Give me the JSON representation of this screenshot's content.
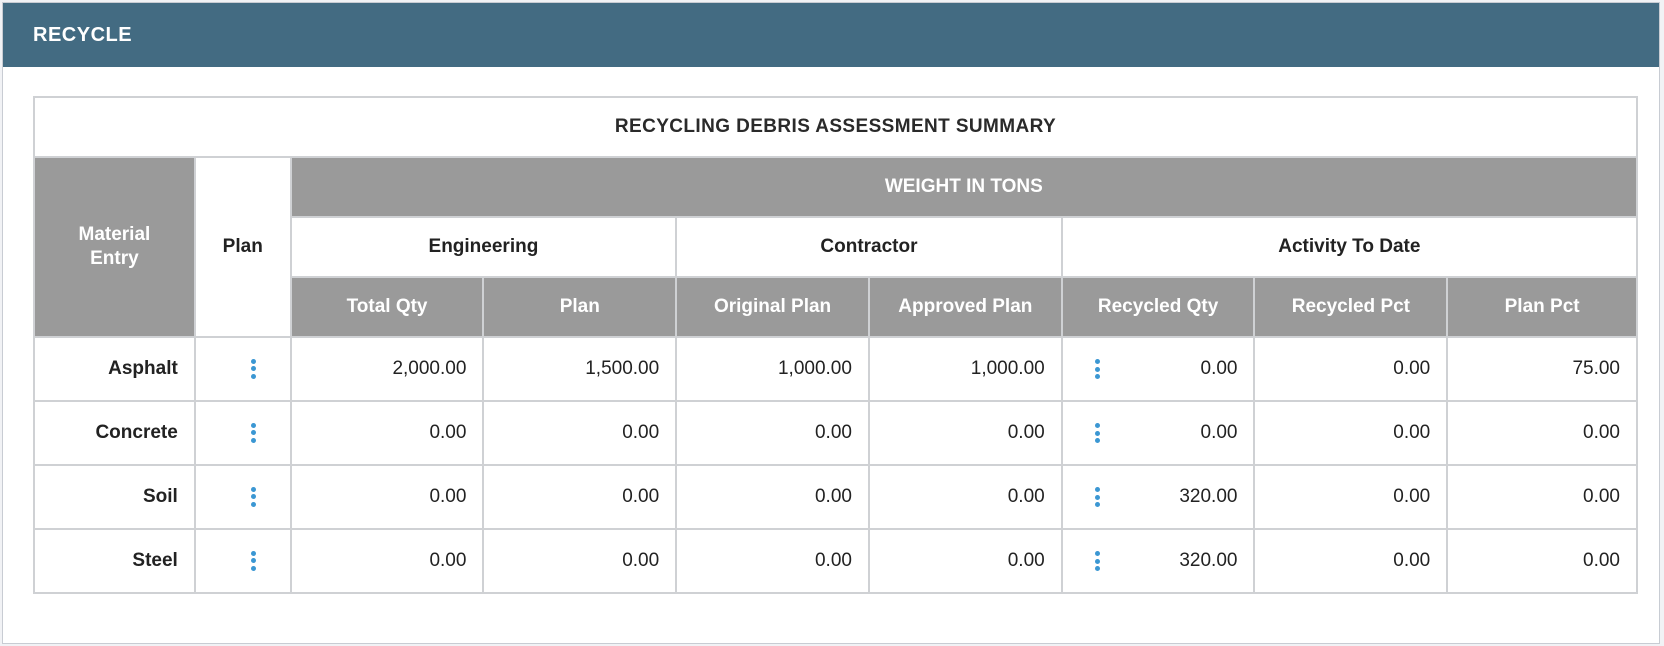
{
  "panel": {
    "title": "RECYCLE"
  },
  "table": {
    "title": "RECYCLING DEBRIS ASSESSMENT SUMMARY",
    "headers": {
      "material_entry": "Material Entry",
      "plan": "Plan",
      "weight_in_tons": "WEIGHT IN TONS",
      "engineering": "Engineering",
      "contractor": "Contractor",
      "activity_to_date": "Activity To Date",
      "total_qty": "Total Qty",
      "eng_plan": "Plan",
      "original_plan": "Original Plan",
      "approved_plan": "Approved Plan",
      "recycled_qty": "Recycled Qty",
      "recycled_pct": "Recycled Pct",
      "plan_pct": "Plan Pct"
    },
    "rows": [
      {
        "material": "Asphalt",
        "total_qty": "2,000.00",
        "plan": "1,500.00",
        "original_plan": "1,000.00",
        "approved_plan": "1,000.00",
        "recycled_qty": "0.00",
        "recycled_pct": "0.00",
        "plan_pct": "75.00"
      },
      {
        "material": "Concrete",
        "total_qty": "0.00",
        "plan": "0.00",
        "original_plan": "0.00",
        "approved_plan": "0.00",
        "recycled_qty": "0.00",
        "recycled_pct": "0.00",
        "plan_pct": "0.00"
      },
      {
        "material": "Soil",
        "total_qty": "0.00",
        "plan": "0.00",
        "original_plan": "0.00",
        "approved_plan": "0.00",
        "recycled_qty": "320.00",
        "recycled_pct": "0.00",
        "plan_pct": "0.00"
      },
      {
        "material": "Steel",
        "total_qty": "0.00",
        "plan": "0.00",
        "original_plan": "0.00",
        "approved_plan": "0.00",
        "recycled_qty": "320.00",
        "recycled_pct": "0.00",
        "plan_pct": "0.00"
      }
    ]
  },
  "icons": {
    "row_menu": "kebab-menu-icon"
  },
  "colors": {
    "header_bg": "#436b82",
    "gray_header": "#9a9a9a",
    "kebab": "#3b97d3"
  }
}
